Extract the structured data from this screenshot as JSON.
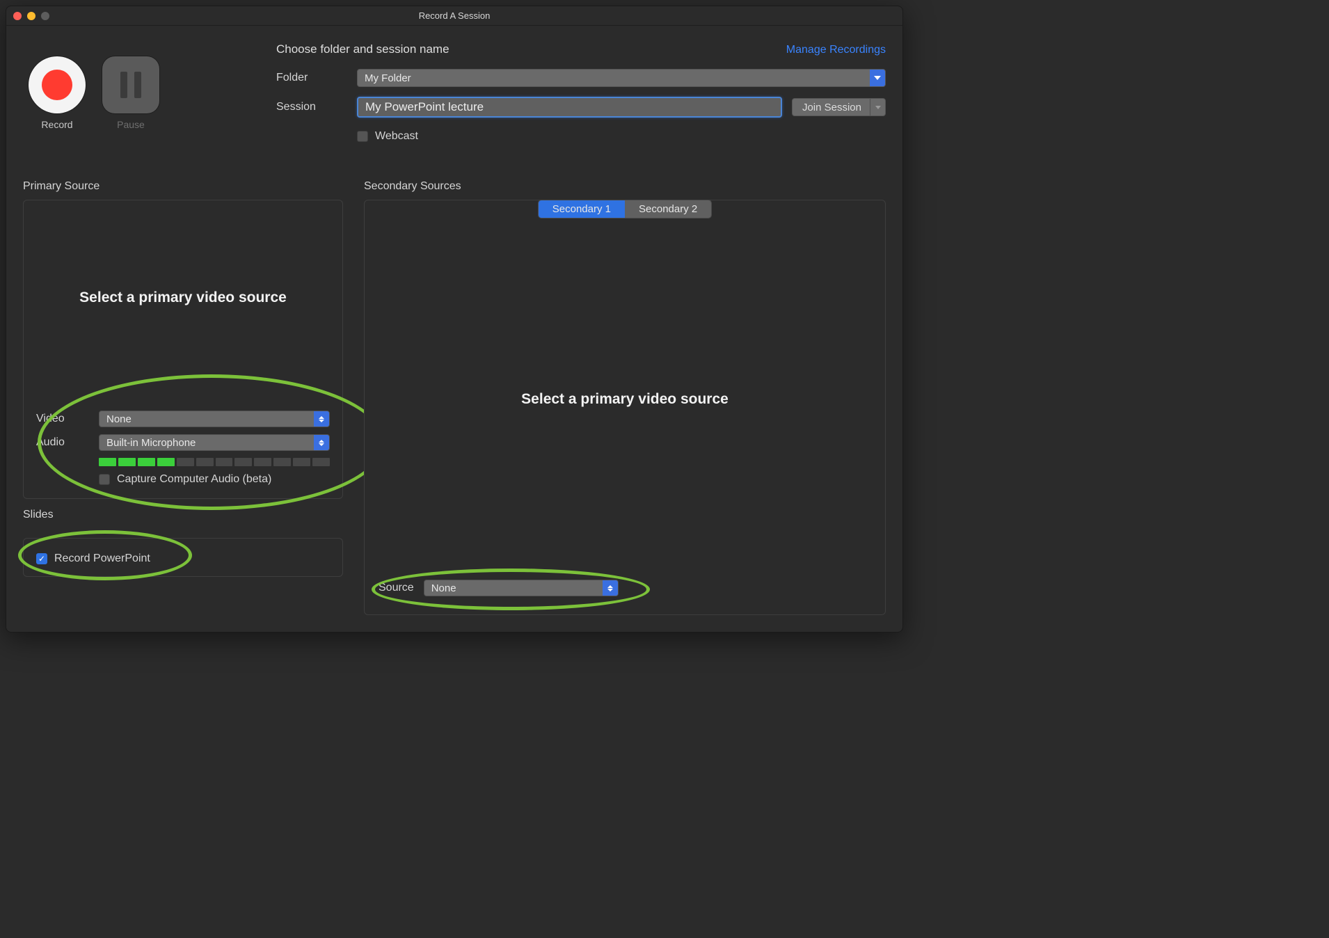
{
  "window": {
    "title": "Record A Session"
  },
  "controls": {
    "record_label": "Record",
    "pause_label": "Pause"
  },
  "form": {
    "heading": "Choose folder and session name",
    "manage_link": "Manage Recordings",
    "folder_label": "Folder",
    "folder_value": "My Folder",
    "session_label": "Session",
    "session_value": "My PowerPoint lecture",
    "join_button": "Join Session",
    "webcast_label": "Webcast",
    "webcast_checked": false
  },
  "primary": {
    "section_label": "Primary Source",
    "prompt": "Select a primary video source",
    "video_label": "Video",
    "video_value": "None",
    "audio_label": "Audio",
    "audio_value": "Built-in Microphone",
    "meter_segments": 12,
    "meter_active": 4,
    "capture_audio_label": "Capture Computer Audio (beta)",
    "capture_audio_checked": false
  },
  "slides": {
    "section_label": "Slides",
    "record_pp_label": "Record PowerPoint",
    "record_pp_checked": true
  },
  "secondary": {
    "section_label": "Secondary Sources",
    "tabs": [
      "Secondary 1",
      "Secondary 2"
    ],
    "active_tab": 0,
    "prompt": "Select a primary video source",
    "source_label": "Source",
    "source_value": "None"
  }
}
